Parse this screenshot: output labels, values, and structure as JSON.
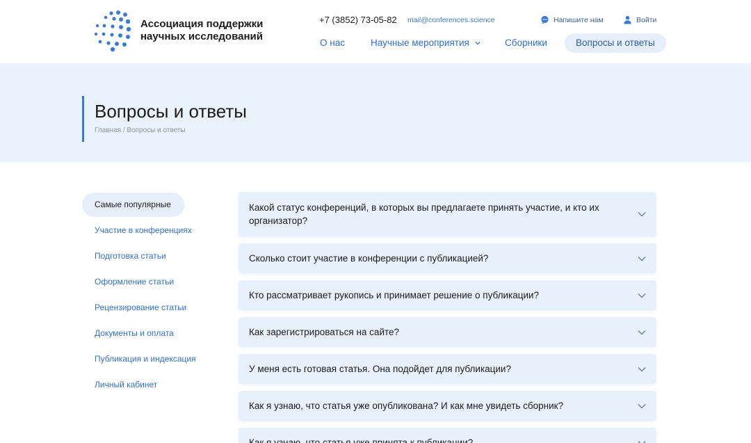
{
  "header": {
    "logo_line1": "Ассоциация поддержки",
    "logo_line2": "научных исследований",
    "phone": "+7 (3852) 73-05-82",
    "email": "mail@conferences.science",
    "write_us": "Напишите нам",
    "login": "Войти"
  },
  "nav": {
    "about": "О нас",
    "events": "Научные мероприятия",
    "collections": "Сборники",
    "faq": "Вопросы и ответы"
  },
  "hero": {
    "title": "Вопросы и ответы",
    "breadcrumb_home": "Главная",
    "breadcrumb_sep": " / ",
    "breadcrumb_current": "Вопросы и ответы"
  },
  "sidebar": {
    "items": [
      {
        "label": "Самые популярные"
      },
      {
        "label": "Участие в конференциях"
      },
      {
        "label": "Подготовка статьи"
      },
      {
        "label": "Оформление статьи"
      },
      {
        "label": "Рецензирование статьи"
      },
      {
        "label": "Документы и оплата"
      },
      {
        "label": "Публикация и индексация"
      },
      {
        "label": "Личный кабинет"
      }
    ]
  },
  "faq": {
    "items": [
      {
        "question": "Какой статус конференций, в которых вы предлагаете принять участие, и кто их организатор?"
      },
      {
        "question": "Сколько стоит участие в конференции с публикацией?"
      },
      {
        "question": "Кто рассматривает рукопись и принимает решение о публикации?"
      },
      {
        "question": "Как зарегистрироваться на сайте?"
      },
      {
        "question": "У меня есть готовая статья. Она подойдет для публикации?"
      },
      {
        "question": "Как я узнаю, что статья уже опубликована? И как мне увидеть сборник?"
      },
      {
        "question": "Как я узнаю, что статья уже принята к публикации?"
      }
    ]
  },
  "colors": {
    "accent": "#3a7bd5",
    "hero_bg": "#eaf2fb",
    "faq_bg": "#e8f0fb"
  }
}
